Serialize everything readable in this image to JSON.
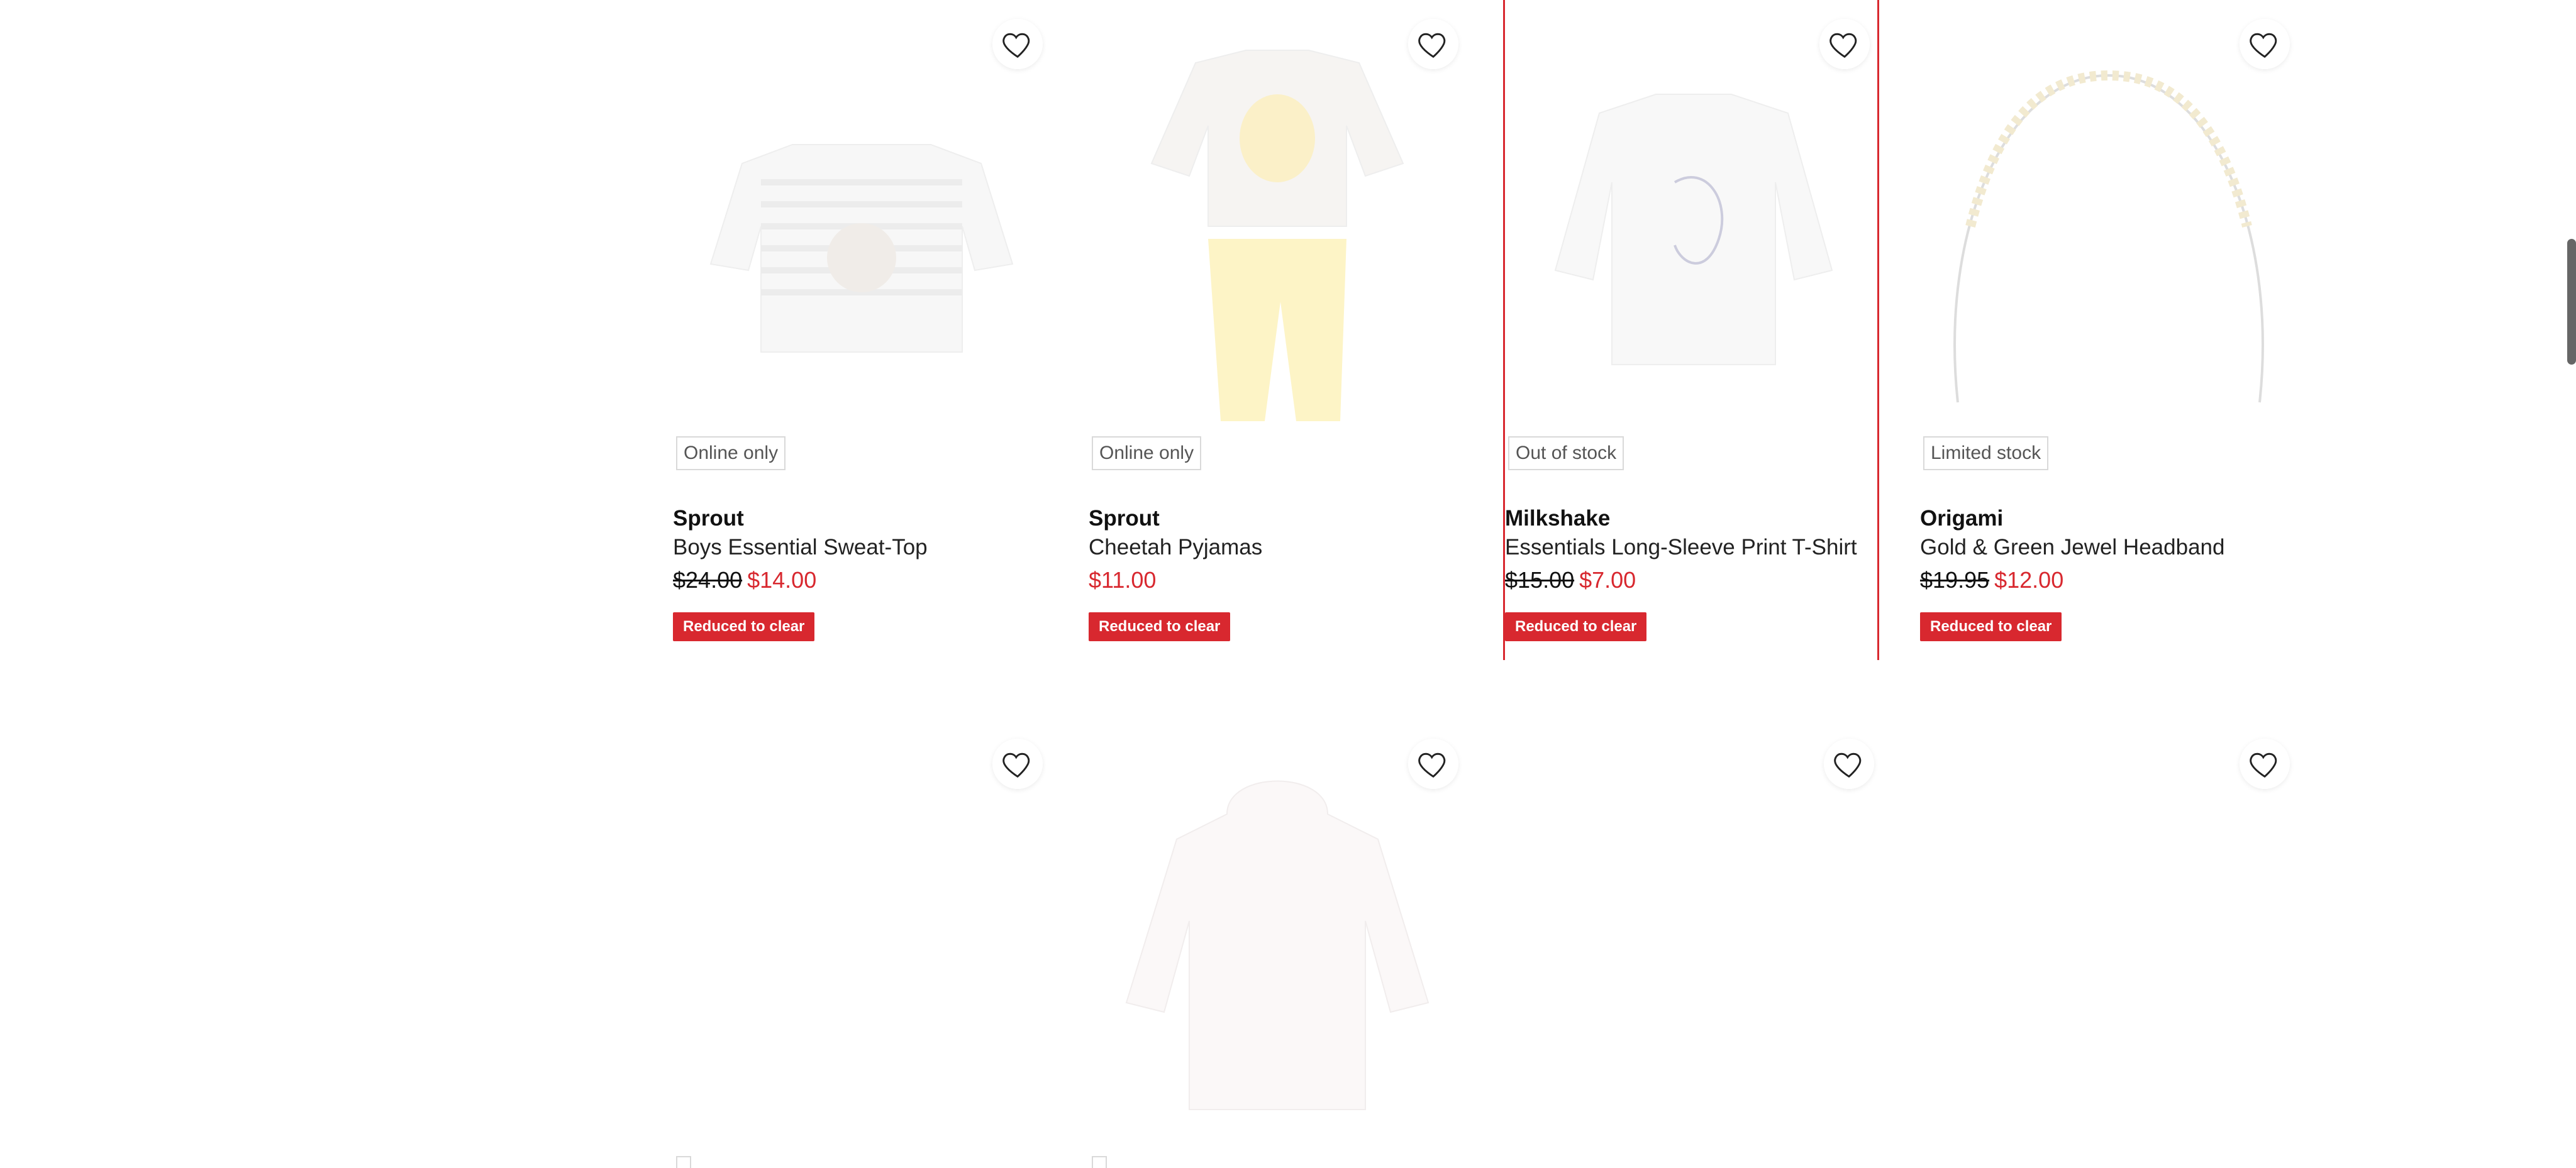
{
  "colors": {
    "accent": "#d8282f",
    "badge_border": "#d9d9d9",
    "text": "#111111"
  },
  "products": [
    {
      "badge": "Online only",
      "brand": "Sprout",
      "name": "Boys Essential Sweat-Top",
      "was_price": "$24.00",
      "now_price": "$14.00",
      "tag": "Reduced to clear",
      "image_icon": "striped-sweat-top-image"
    },
    {
      "badge": "Online only",
      "brand": "Sprout",
      "name": "Cheetah Pyjamas",
      "was_price": "",
      "now_price": "$11.00",
      "tag": "Reduced to clear",
      "image_icon": "cheetah-pyjamas-image"
    },
    {
      "badge": "Out of stock",
      "brand": "Milkshake",
      "name": "Essentials Long-Sleeve Print T-Shirt",
      "was_price": "$15.00",
      "now_price": "$7.00",
      "tag": "Reduced to clear",
      "image_icon": "unicorn-tshirt-image"
    },
    {
      "badge": "Limited stock",
      "brand": "Origami",
      "name": "Gold & Green Jewel Headband",
      "was_price": "$19.95",
      "now_price": "$12.00",
      "tag": "Reduced to clear",
      "image_icon": "jewel-headband-image"
    }
  ],
  "wishlist_icon": "heart-outline-icon"
}
